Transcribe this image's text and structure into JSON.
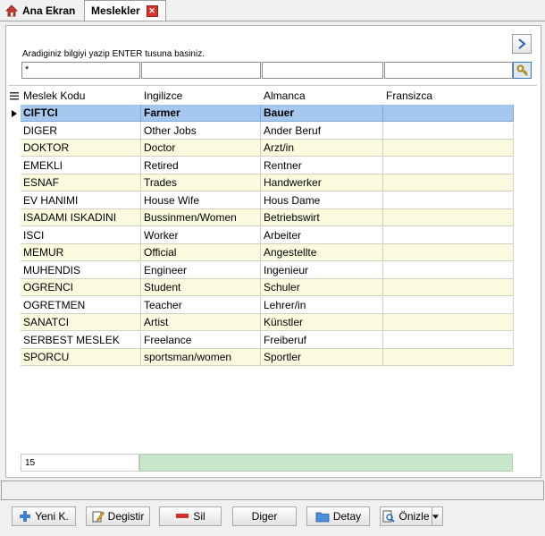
{
  "tabs": [
    {
      "label": "Ana Ekran"
    },
    {
      "label": "Meslekler"
    }
  ],
  "search": {
    "hint": "Aradiginiz bilgiyi yazip ENTER tusuna basiniz.",
    "filter_values": [
      "*",
      "",
      "",
      ""
    ]
  },
  "grid": {
    "headers": [
      "Meslek Kodu",
      "Ingilizce",
      "Almanca",
      "Fransizca"
    ],
    "rows": [
      [
        "CIFTCI",
        "Farmer",
        "Bauer",
        ""
      ],
      [
        "DIGER",
        "Other Jobs",
        "Ander Beruf",
        ""
      ],
      [
        "DOKTOR",
        "Doctor",
        "Arzt/in",
        ""
      ],
      [
        "EMEKLI",
        "Retired",
        "Rentner",
        ""
      ],
      [
        "ESNAF",
        "Trades",
        "Handwerker",
        ""
      ],
      [
        "EV HANIMI",
        "House Wife",
        "Hous Dame",
        ""
      ],
      [
        "ISADAMI ISKADINI",
        "Bussinmen/Women",
        "Betriebswirt",
        ""
      ],
      [
        "ISCI",
        "Worker",
        "Arbeiter",
        ""
      ],
      [
        "MEMUR",
        "Official",
        "Angestellte",
        ""
      ],
      [
        "MUHENDIS",
        "Engineer",
        "Ingenieur",
        ""
      ],
      [
        "OGRENCI",
        "Student",
        "Schuler",
        ""
      ],
      [
        "OGRETMEN",
        "Teacher",
        "Lehrer/in",
        ""
      ],
      [
        "SANATCI",
        "Artist",
        "Künstler",
        ""
      ],
      [
        "SERBEST MESLEK",
        "Freelance",
        "Freiberuf",
        ""
      ],
      [
        "SPORCU",
        "sportsman/women",
        "Sportler",
        ""
      ]
    ],
    "selected_row": 0,
    "record_count": "15"
  },
  "buttons": {
    "new": "Yeni K.",
    "edit": "Degistir",
    "delete": "Sil",
    "other": "Diger",
    "detail": "Detay",
    "preview": "Önizle"
  },
  "colors": {
    "selected_row": "#a6c8ef",
    "odd_row": "#fbfbe0",
    "footer_bar": "#c8e6c9"
  }
}
